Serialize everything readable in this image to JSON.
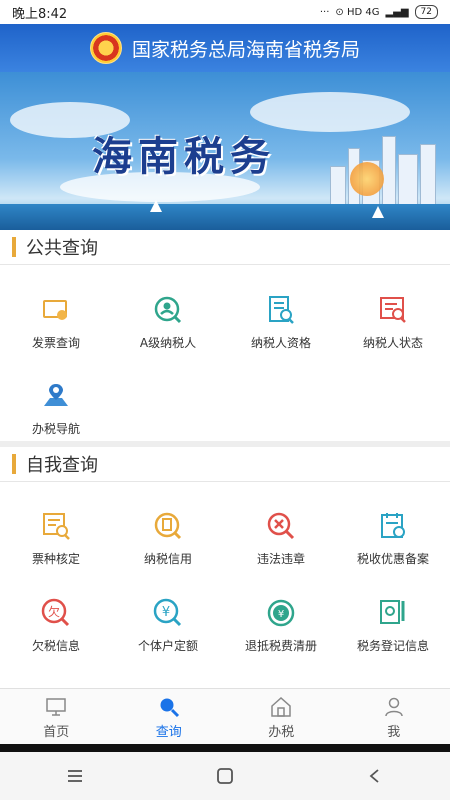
{
  "status_bar": {
    "time": "晚上8:42",
    "icons": "⊙ HD 4G",
    "battery": "72"
  },
  "header": {
    "title": "国家税务总局海南省税务局"
  },
  "banner": {
    "title": "海南税务"
  },
  "public_query": {
    "title": "公共查询",
    "items": [
      {
        "label": "发票查询",
        "icon": "invoice-search-icon"
      },
      {
        "label": "A级纳税人",
        "icon": "a-level-taxpayer-icon"
      },
      {
        "label": "纳税人资格",
        "icon": "taxpayer-qualification-icon"
      },
      {
        "label": "纳税人状态",
        "icon": "taxpayer-status-icon"
      },
      {
        "label": "办税导航",
        "icon": "tax-navigation-icon"
      }
    ]
  },
  "self_query": {
    "title": "自我查询",
    "items": [
      {
        "label": "票种核定",
        "icon": "ticket-type-icon"
      },
      {
        "label": "纳税信用",
        "icon": "tax-credit-icon"
      },
      {
        "label": "违法违章",
        "icon": "violation-icon"
      },
      {
        "label": "税收优惠备案",
        "icon": "tax-preference-icon"
      },
      {
        "label": "欠税信息",
        "icon": "tax-arrears-icon"
      },
      {
        "label": "个体户定额",
        "icon": "individual-quota-icon"
      },
      {
        "label": "退抵税费清册",
        "icon": "tax-refund-icon"
      },
      {
        "label": "税务登记信息",
        "icon": "tax-registration-icon"
      }
    ]
  },
  "tab_bar": [
    {
      "label": "首页",
      "icon": "home-icon"
    },
    {
      "label": "查询",
      "icon": "search-icon",
      "active": true
    },
    {
      "label": "办税",
      "icon": "tax-office-icon"
    },
    {
      "label": "我",
      "icon": "profile-icon"
    }
  ],
  "colors": {
    "header": "#2a6fd6",
    "accent": "#1a73e8",
    "section_bar": "#e8a93a"
  }
}
